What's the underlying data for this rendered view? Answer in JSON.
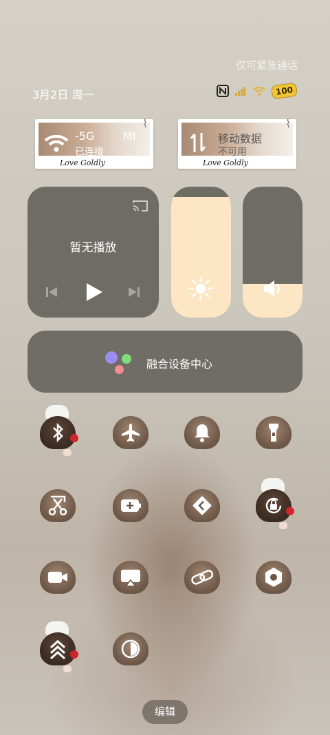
{
  "status_bar": {
    "emergency_text": "仅可紧急通话",
    "date": "3月2日 周一",
    "battery": "100",
    "icons": [
      "nfc-icon",
      "signal-icon",
      "wifi-icon",
      "battery-icon"
    ]
  },
  "cards": {
    "wifi": {
      "name_partial": "-5G",
      "extra": "MI",
      "status": "已连接",
      "signature": "Love Goldly",
      "icon": "wifi-icon"
    },
    "mobile_data": {
      "title": "移动数据",
      "status": "不可用",
      "signature": "Love Goldly",
      "icon": "data-arrows-icon"
    }
  },
  "media": {
    "title": "暂无播放",
    "icons": [
      "cast-icon",
      "previous-icon",
      "play-icon",
      "next-icon"
    ]
  },
  "sliders": {
    "brightness_level": 0.92,
    "volume_level": 0.26
  },
  "fusion": {
    "label": "融合设备中心",
    "dot_colors": [
      "#9b8cf0",
      "#7fdf7a",
      "#f38d8d"
    ]
  },
  "toggles": [
    {
      "name": "bluetooth",
      "icon": "bluetooth-icon",
      "active": true
    },
    {
      "name": "airplane",
      "icon": "airplane-icon",
      "active": false
    },
    {
      "name": "silent",
      "icon": "bell-icon",
      "active": false
    },
    {
      "name": "flashlight",
      "icon": "flashlight-icon",
      "active": false
    },
    {
      "name": "screenshot",
      "icon": "scissors-icon",
      "active": false
    },
    {
      "name": "battery-saver",
      "icon": "battery-plus-icon",
      "active": false
    },
    {
      "name": "location",
      "icon": "navigation-icon",
      "active": false
    },
    {
      "name": "rotation-lock",
      "icon": "rotation-lock-icon",
      "active": true
    },
    {
      "name": "screen-record",
      "icon": "video-icon",
      "active": false
    },
    {
      "name": "cast-screen",
      "icon": "screen-cast-icon",
      "active": false
    },
    {
      "name": "hotspot",
      "icon": "link-icon",
      "active": false
    },
    {
      "name": "settings",
      "icon": "hexagon-icon",
      "active": false
    },
    {
      "name": "performance",
      "icon": "chevrons-up-icon",
      "active": true
    },
    {
      "name": "dark-mode",
      "icon": "contrast-icon",
      "active": false
    }
  ],
  "edit_label": "编辑"
}
